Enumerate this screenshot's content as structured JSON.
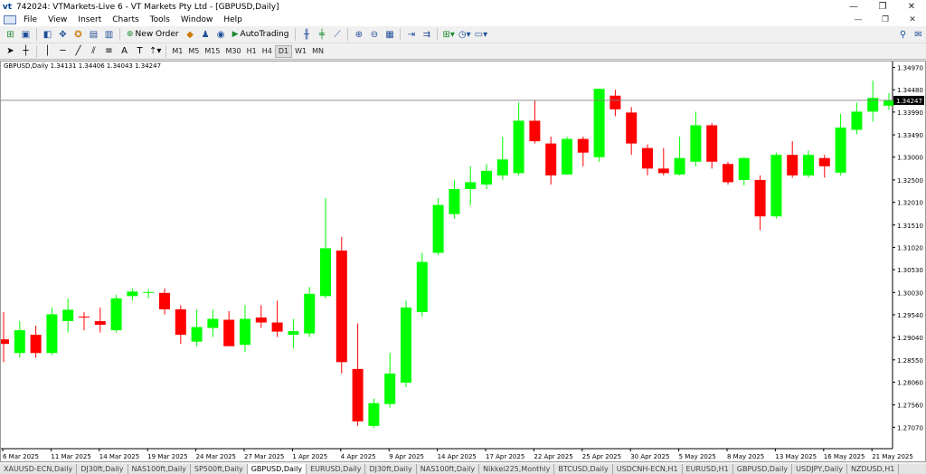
{
  "window": {
    "logo": "vt",
    "title": "742024: VTMarkets-Live 6 - VT Markets Pty Ltd - [GBPUSD,Daily]",
    "buttons": [
      "—",
      "❐",
      "✕"
    ]
  },
  "menu": {
    "items": [
      "File",
      "View",
      "Insert",
      "Charts",
      "Tools",
      "Window",
      "Help"
    ],
    "mdi_buttons": [
      "—",
      "❐",
      "✕"
    ]
  },
  "toolbar": {
    "new_order_label": "New Order",
    "autotrading_label": "AutoTrading",
    "timeframes": [
      "M1",
      "M5",
      "M15",
      "M30",
      "H1",
      "H4",
      "D1",
      "W1",
      "MN"
    ],
    "active_timeframe": "D1"
  },
  "chart_header": "GBPUSD,Daily  1.34131 1.34406 1.34043 1.34247",
  "chart_data": {
    "type": "candlestick",
    "symbol": "GBPUSD",
    "timeframe": "Daily",
    "current_price": 1.34247,
    "ylim": [
      1.266,
      1.351
    ],
    "y_ticks": [
      "1.34970",
      "1.34480",
      "1.33990",
      "1.33490",
      "1.33000",
      "1.32500",
      "1.32010",
      "1.31510",
      "1.31020",
      "1.30530",
      "1.30030",
      "1.29540",
      "1.29040",
      "1.28550",
      "1.28060",
      "1.27560",
      "1.27070"
    ],
    "x_labels": [
      "6 Mar 2025",
      "11 Mar 2025",
      "14 Mar 2025",
      "19 Mar 2025",
      "24 Mar 2025",
      "27 Mar 2025",
      "1 Apr 2025",
      "4 Apr 2025",
      "9 Apr 2025",
      "14 Apr 2025",
      "17 Apr 2025",
      "22 Apr 2025",
      "25 Apr 2025",
      "30 Apr 2025",
      "5 May 2025",
      "8 May 2025",
      "13 May 2025",
      "16 May 2025",
      "21 May 2025"
    ],
    "up_color": "#00ff00",
    "down_color": "#ff0000",
    "candles": [
      {
        "o": 1.29,
        "h": 1.296,
        "l": 1.285,
        "c": 1.289
      },
      {
        "o": 1.287,
        "h": 1.294,
        "l": 1.286,
        "c": 1.292
      },
      {
        "o": 1.291,
        "h": 1.293,
        "l": 1.286,
        "c": 1.287
      },
      {
        "o": 1.287,
        "h": 1.297,
        "l": 1.2865,
        "c": 1.2955
      },
      {
        "o": 1.294,
        "h": 1.299,
        "l": 1.2915,
        "c": 1.2965
      },
      {
        "o": 1.295,
        "h": 1.296,
        "l": 1.292,
        "c": 1.2948
      },
      {
        "o": 1.294,
        "h": 1.297,
        "l": 1.2915,
        "c": 1.2932
      },
      {
        "o": 1.292,
        "h": 1.2998,
        "l": 1.2915,
        "c": 1.299
      },
      {
        "o": 1.2995,
        "h": 1.3012,
        "l": 1.2985,
        "c": 1.3005
      },
      {
        "o": 1.3002,
        "h": 1.301,
        "l": 1.299,
        "c": 1.3004
      },
      {
        "o": 1.3002,
        "h": 1.3012,
        "l": 1.2955,
        "c": 1.2966
      },
      {
        "o": 1.2966,
        "h": 1.2975,
        "l": 1.289,
        "c": 1.291
      },
      {
        "o": 1.2895,
        "h": 1.2965,
        "l": 1.2885,
        "c": 1.2927
      },
      {
        "o": 1.2925,
        "h": 1.2965,
        "l": 1.2905,
        "c": 1.2945
      },
      {
        "o": 1.2943,
        "h": 1.2962,
        "l": 1.2885,
        "c": 1.2885
      },
      {
        "o": 1.2888,
        "h": 1.2975,
        "l": 1.2872,
        "c": 1.2945
      },
      {
        "o": 1.2948,
        "h": 1.2975,
        "l": 1.2925,
        "c": 1.2937
      },
      {
        "o": 1.2937,
        "h": 1.2985,
        "l": 1.2905,
        "c": 1.2917
      },
      {
        "o": 1.291,
        "h": 1.2945,
        "l": 1.288,
        "c": 1.2918
      },
      {
        "o": 1.2913,
        "h": 1.3015,
        "l": 1.2905,
        "c": 1.3
      },
      {
        "o": 1.2995,
        "h": 1.321,
        "l": 1.299,
        "c": 1.31
      },
      {
        "o": 1.3095,
        "h": 1.3125,
        "l": 1.2825,
        "c": 1.285
      },
      {
        "o": 1.2835,
        "h": 1.2935,
        "l": 1.271,
        "c": 1.272
      },
      {
        "o": 1.271,
        "h": 1.277,
        "l": 1.2705,
        "c": 1.276
      },
      {
        "o": 1.2758,
        "h": 1.287,
        "l": 1.275,
        "c": 1.2825
      },
      {
        "o": 1.2805,
        "h": 1.2985,
        "l": 1.2795,
        "c": 1.297
      },
      {
        "o": 1.296,
        "h": 1.309,
        "l": 1.295,
        "c": 1.307
      },
      {
        "o": 1.309,
        "h": 1.321,
        "l": 1.3085,
        "c": 1.3195
      },
      {
        "o": 1.3175,
        "h": 1.325,
        "l": 1.3165,
        "c": 1.323
      },
      {
        "o": 1.323,
        "h": 1.328,
        "l": 1.3195,
        "c": 1.3245
      },
      {
        "o": 1.324,
        "h": 1.3285,
        "l": 1.323,
        "c": 1.327
      },
      {
        "o": 1.326,
        "h": 1.3345,
        "l": 1.325,
        "c": 1.3295
      },
      {
        "o": 1.3265,
        "h": 1.342,
        "l": 1.326,
        "c": 1.338
      },
      {
        "o": 1.338,
        "h": 1.3425,
        "l": 1.333,
        "c": 1.3335
      },
      {
        "o": 1.333,
        "h": 1.3345,
        "l": 1.324,
        "c": 1.326
      },
      {
        "o": 1.3262,
        "h": 1.3345,
        "l": 1.3262,
        "c": 1.334
      },
      {
        "o": 1.334,
        "h": 1.3345,
        "l": 1.328,
        "c": 1.331
      },
      {
        "o": 1.33,
        "h": 1.345,
        "l": 1.329,
        "c": 1.345
      },
      {
        "o": 1.3435,
        "h": 1.3448,
        "l": 1.339,
        "c": 1.3405
      },
      {
        "o": 1.3398,
        "h": 1.341,
        "l": 1.3305,
        "c": 1.333
      },
      {
        "o": 1.332,
        "h": 1.3328,
        "l": 1.326,
        "c": 1.3275
      },
      {
        "o": 1.3275,
        "h": 1.332,
        "l": 1.326,
        "c": 1.3265
      },
      {
        "o": 1.3262,
        "h": 1.3345,
        "l": 1.326,
        "c": 1.3298
      },
      {
        "o": 1.329,
        "h": 1.34,
        "l": 1.328,
        "c": 1.337
      },
      {
        "o": 1.337,
        "h": 1.3375,
        "l": 1.3275,
        "c": 1.329
      },
      {
        "o": 1.3285,
        "h": 1.329,
        "l": 1.324,
        "c": 1.3245
      },
      {
        "o": 1.325,
        "h": 1.33,
        "l": 1.3238,
        "c": 1.3298
      },
      {
        "o": 1.325,
        "h": 1.326,
        "l": 1.314,
        "c": 1.317
      },
      {
        "o": 1.317,
        "h": 1.331,
        "l": 1.3165,
        "c": 1.3305
      },
      {
        "o": 1.3305,
        "h": 1.3335,
        "l": 1.3255,
        "c": 1.326
      },
      {
        "o": 1.326,
        "h": 1.3315,
        "l": 1.3255,
        "c": 1.3305
      },
      {
        "o": 1.3298,
        "h": 1.3305,
        "l": 1.3255,
        "c": 1.328
      },
      {
        "o": 1.3266,
        "h": 1.3395,
        "l": 1.326,
        "c": 1.3365
      },
      {
        "o": 1.336,
        "h": 1.342,
        "l": 1.335,
        "c": 1.34
      },
      {
        "o": 1.34,
        "h": 1.3468,
        "l": 1.3378,
        "c": 1.343
      },
      {
        "o": 1.3413,
        "h": 1.3441,
        "l": 1.3404,
        "c": 1.3425
      }
    ]
  },
  "tabs": [
    "XAUUSD-ECN,Daily",
    "DJ30ft,Daily",
    "NAS100ft,Daily",
    "SP500ft,Daily",
    "GBPUSD,Daily",
    "EURUSD,Daily",
    "DJ30ft,Daily",
    "NAS100ft,Daily",
    "Nikkei225,Monthly",
    "BTCUSD,Daily",
    "USDCNH-ECN,H1",
    "EURUSD,H1",
    "GBPUSD,Daily",
    "USDJPY,Daily",
    "NZDUSD,H1"
  ],
  "active_tab": "GBPUSD,Daily"
}
